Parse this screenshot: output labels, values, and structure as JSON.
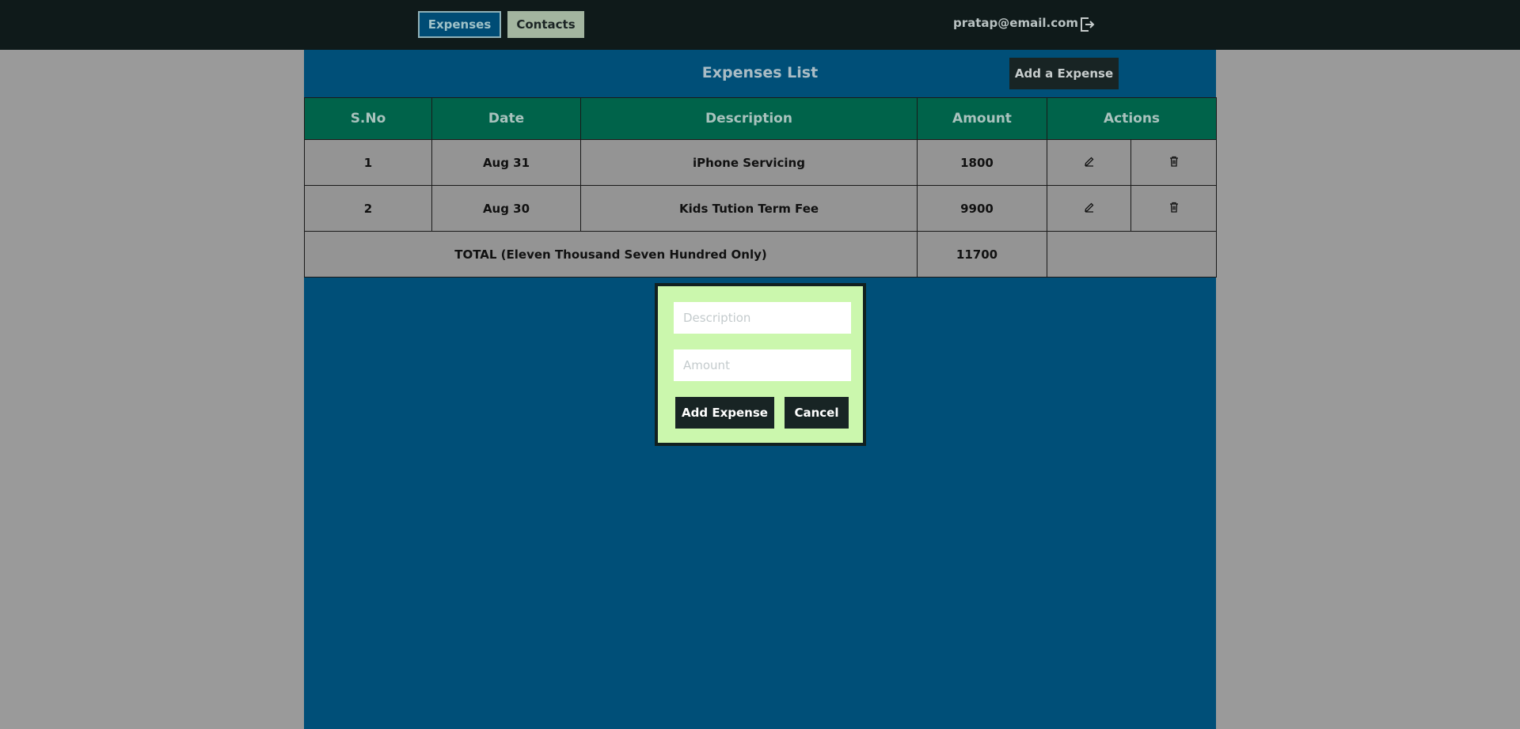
{
  "nav": {
    "tabs": [
      {
        "label": "Expenses",
        "active": true
      },
      {
        "label": "Contacts",
        "active": false
      }
    ],
    "user_email": "pratap@email.com",
    "logout_icon": "logout-icon"
  },
  "expenses": {
    "title": "Expenses List",
    "add_button": "Add a Expense",
    "columns": [
      "S.No",
      "Date",
      "Description",
      "Amount",
      "Actions"
    ],
    "rows": [
      {
        "sno": "1",
        "date": "Aug 31",
        "description": "iPhone Servicing",
        "amount": "1800"
      },
      {
        "sno": "2",
        "date": "Aug 30",
        "description": "Kids Tution Term Fee",
        "amount": "9900"
      }
    ],
    "total_label": "TOTAL (Eleven Thousand Seven Hundred Only)",
    "total_amount": "11700",
    "row_actions": [
      "edit-icon",
      "delete-icon"
    ]
  },
  "modal": {
    "description_placeholder": "Description",
    "amount_placeholder": "Amount",
    "description_value": "",
    "amount_value": "",
    "add_button": "Add Expense",
    "cancel_button": "Cancel"
  },
  "colors": {
    "topbar": "#0f1a1a",
    "panel": "#004f78",
    "header_row": "#00634a",
    "modal_bg": "#cbf7ad"
  }
}
